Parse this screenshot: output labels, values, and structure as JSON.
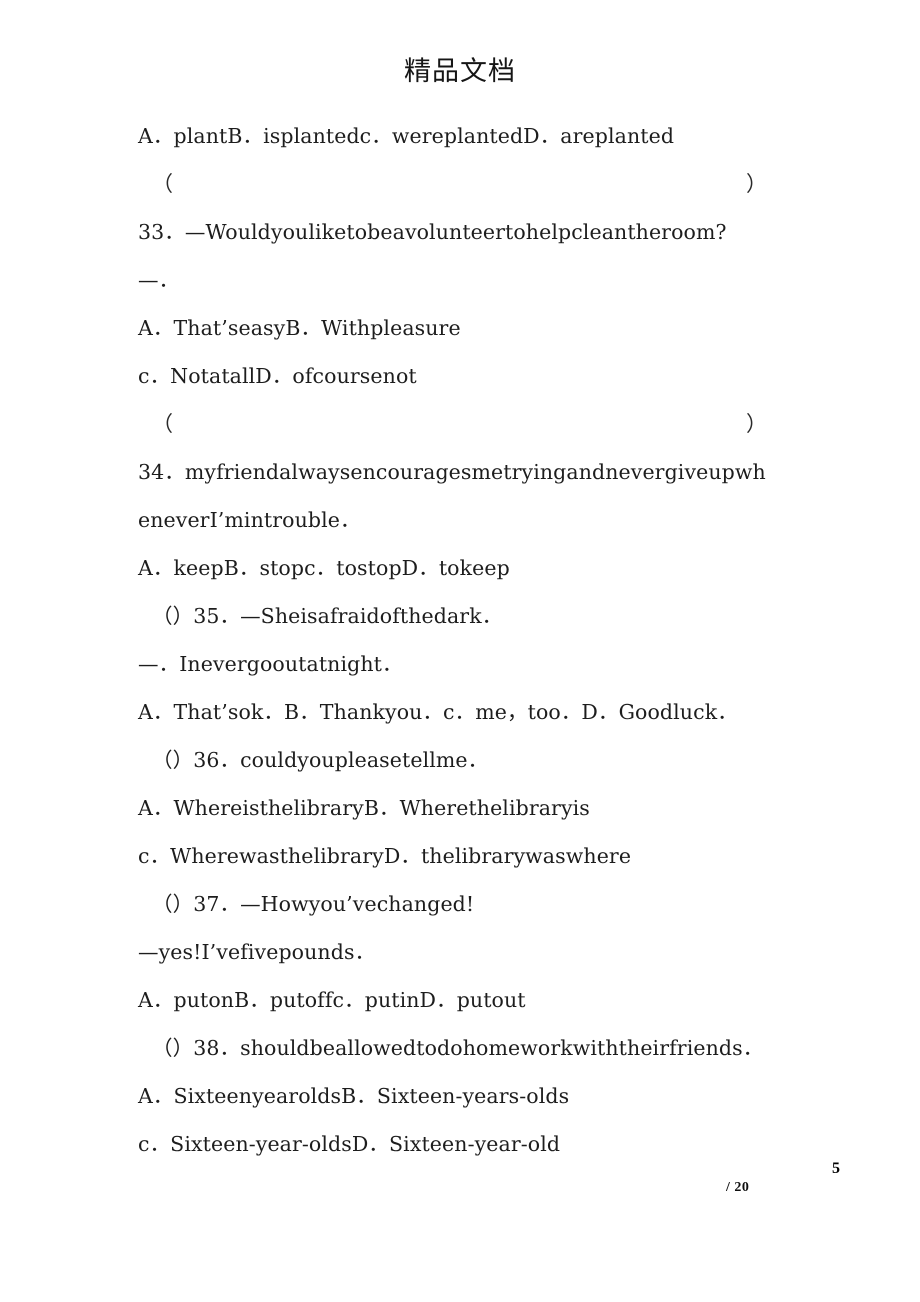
{
  "header": {
    "watermark_title": "精品文档"
  },
  "footer": {
    "page_number": "5",
    "page_total": "/ 20"
  },
  "blank_row": {
    "open_paren": "（",
    "close_paren": "）"
  },
  "body": {
    "lines": [
      {
        "id": "q32-options",
        "text": "A．plantB．isplantedc．wereplantedD．areplanted",
        "indent": false
      },
      {
        "id": "blank-1",
        "type": "blank"
      },
      {
        "id": "q33-stem",
        "text": "33．—Wouldyouliketobeavolunteertohelpcleantheroom?",
        "indent": false
      },
      {
        "id": "q33-reply",
        "text": "—．",
        "indent": false
      },
      {
        "id": "q33-opt-ab",
        "text": "A．That’seasyB．Withpleasure",
        "indent": false
      },
      {
        "id": "q33-opt-cd",
        "text": "c．NotatallD．ofcoursenot",
        "indent": false
      },
      {
        "id": "blank-2",
        "type": "blank"
      },
      {
        "id": "q34-stem-1",
        "text": "34．myfriendalwaysencouragesmetryingandnevergiveupwh",
        "indent": false
      },
      {
        "id": "q34-stem-2",
        "text": "eneverI’mintrouble．",
        "indent": false
      },
      {
        "id": "q34-options",
        "text": "A．keepB．stopc．tostopD．tokeep",
        "indent": false
      },
      {
        "id": "q35-stem",
        "text": "（）35．—Sheisafraidofthedark．",
        "indent": true
      },
      {
        "id": "q35-reply",
        "text": "—．Inevergooutatnight．",
        "indent": false
      },
      {
        "id": "q35-options",
        "text": "A．That’sok．B．Thankyou．c．me，too．D．Goodluck．",
        "indent": false
      },
      {
        "id": "q36-stem",
        "text": "（）36．couldyoupleasetellme．",
        "indent": true
      },
      {
        "id": "q36-opt-ab",
        "text": "A．WhereisthelibraryB．Wherethelibraryis",
        "indent": false
      },
      {
        "id": "q36-opt-cd",
        "text": "c．WherewasthelibraryD．thelibrarywaswhere",
        "indent": false
      },
      {
        "id": "q37-stem",
        "text": "（）37．—Howyou’vechanged!",
        "indent": true
      },
      {
        "id": "q37-reply",
        "text": "—yes!I’vefivepounds．",
        "indent": false
      },
      {
        "id": "q37-options",
        "text": "A．putonB．putoffc．putinD．putout",
        "indent": false
      },
      {
        "id": "q38-stem",
        "text": "（）38．shouldbeallowedtodohomeworkwiththeirfriends．",
        "indent": true
      },
      {
        "id": "q38-opt-ab",
        "text": "A．SixteenyearoldsB．Sixteen-years-olds",
        "indent": false
      },
      {
        "id": "q38-opt-cd",
        "text": "c．Sixteen-year-oldsD．Sixteen-year-old",
        "indent": false
      }
    ]
  }
}
